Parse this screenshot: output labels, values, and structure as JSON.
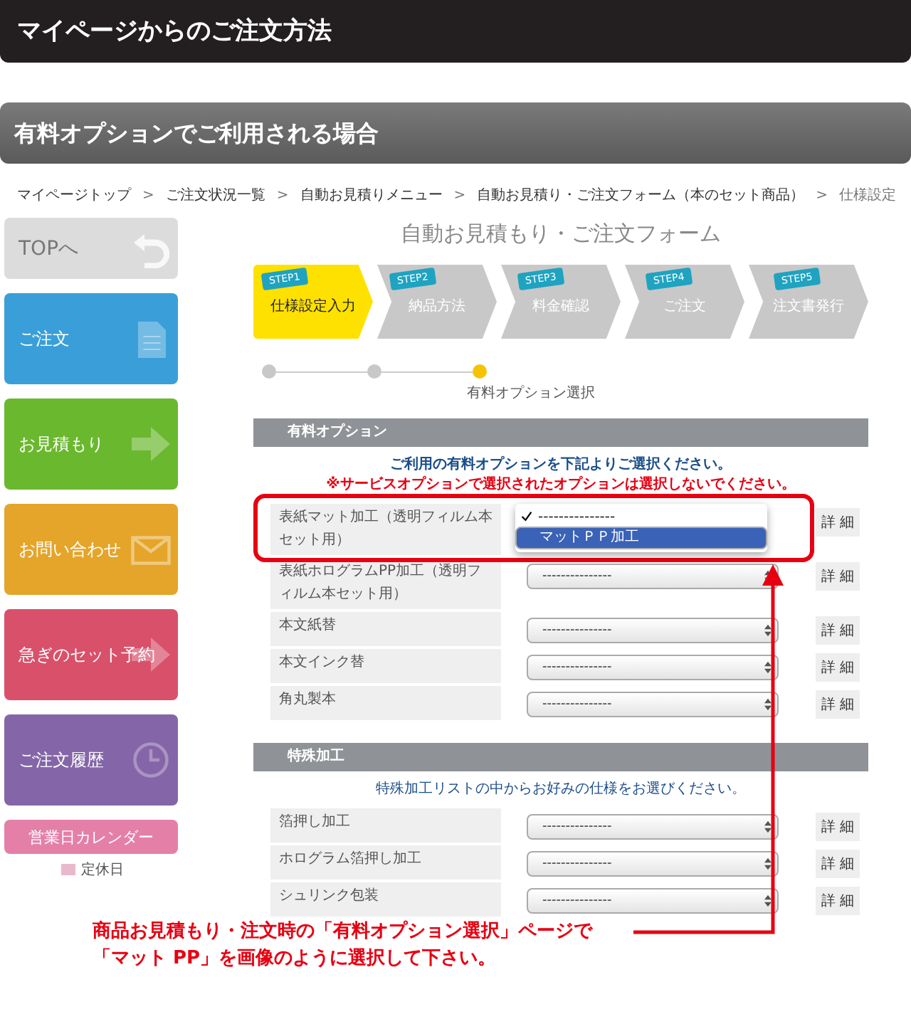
{
  "page_title": "マイページからのご注文方法",
  "section_title": "有料オプションでご利用される場合",
  "breadcrumb": [
    {
      "label": "マイページトップ"
    },
    {
      "separator": ">",
      "label": "ご注文状況一覧"
    },
    {
      "separator": ">",
      "label": "自動お見積りメニュー"
    },
    {
      "separator": ">",
      "label": "自動お見積り・ご注文フォーム（本のセット商品）"
    },
    {
      "separator": ">",
      "label": "仕様設定"
    }
  ],
  "sidebar": {
    "items": [
      {
        "label": "TOPへ",
        "kind": "top",
        "color": "#dcdcdc"
      },
      {
        "label": "ご注文",
        "kind": "order",
        "color": "#3a9fd8"
      },
      {
        "label": "お見積もり",
        "kind": "estimate",
        "color": "#6ab82e"
      },
      {
        "label": "お問い合わせ",
        "kind": "contact",
        "color": "#e5a52a"
      },
      {
        "label": "急ぎのセット予約",
        "kind": "urgent",
        "color": "#d9506a"
      },
      {
        "label": "ご注文履歴",
        "kind": "history",
        "color": "#8466a8"
      }
    ],
    "calendar_button": "営業日カレンダー",
    "legend": "定休日"
  },
  "form": {
    "title": "自動お見積もり・ご注文フォーム",
    "steps": [
      {
        "tag": "STEP1",
        "label": "仕様設定入力",
        "selected": true
      },
      {
        "tag": "STEP2",
        "label": "納品方法",
        "selected": false
      },
      {
        "tag": "STEP3",
        "label": "料金確認",
        "selected": false
      },
      {
        "tag": "STEP4",
        "label": "ご注文",
        "selected": false
      },
      {
        "tag": "STEP5",
        "label": "注文書発行",
        "selected": false
      }
    ],
    "progress": {
      "dots": [
        {
          "selected": false
        },
        {
          "selected": false
        },
        {
          "selected": true
        }
      ],
      "label": "有料オプション選択"
    },
    "sections": [
      {
        "title": "有料オプション",
        "notes": [
          {
            "text": "ご利用の有料オプションを下記よりご選択ください。",
            "kind": "info"
          },
          {
            "text": "※サービスオプションで選択されたオプションは選択しないでください。",
            "kind": "warning"
          }
        ],
        "rows": [
          {
            "label": "表紙マット加工（透明フィルム本セット用）",
            "expanded": true,
            "options": [
              {
                "label": "---------------",
                "checked": true,
                "selected": false
              },
              {
                "label": "マットＰＰ加工",
                "checked": false,
                "selected": true
              }
            ],
            "detail": "詳 細"
          },
          {
            "label": "表紙ホログラムPP加工（透明フィルム本セット用）",
            "value": "---------------",
            "detail": "詳 細"
          },
          {
            "label": "本文紙替",
            "value": "---------------",
            "detail": "詳 細"
          },
          {
            "label": "本文インク替",
            "value": "---------------",
            "detail": "詳 細"
          },
          {
            "label": "角丸製本",
            "value": "---------------",
            "detail": "詳 細"
          }
        ]
      },
      {
        "title": "特殊加工",
        "notes": [
          {
            "text": "特殊加工リストの中からお好みの仕様をお選びください。",
            "kind": "plain"
          }
        ],
        "rows": [
          {
            "label": "箔押し加工",
            "value": "---------------",
            "detail": "詳 細"
          },
          {
            "label": "ホログラム箔押し加工",
            "value": "---------------",
            "detail": "詳 細"
          },
          {
            "label": "シュリンク包装",
            "value": "---------------",
            "detail": "詳 細"
          }
        ]
      }
    ]
  },
  "annotation": [
    "商品お見積もり・注文時の「有料オプション選択」ページで",
    "「マット PP」を画像のように選択して下さい。"
  ]
}
